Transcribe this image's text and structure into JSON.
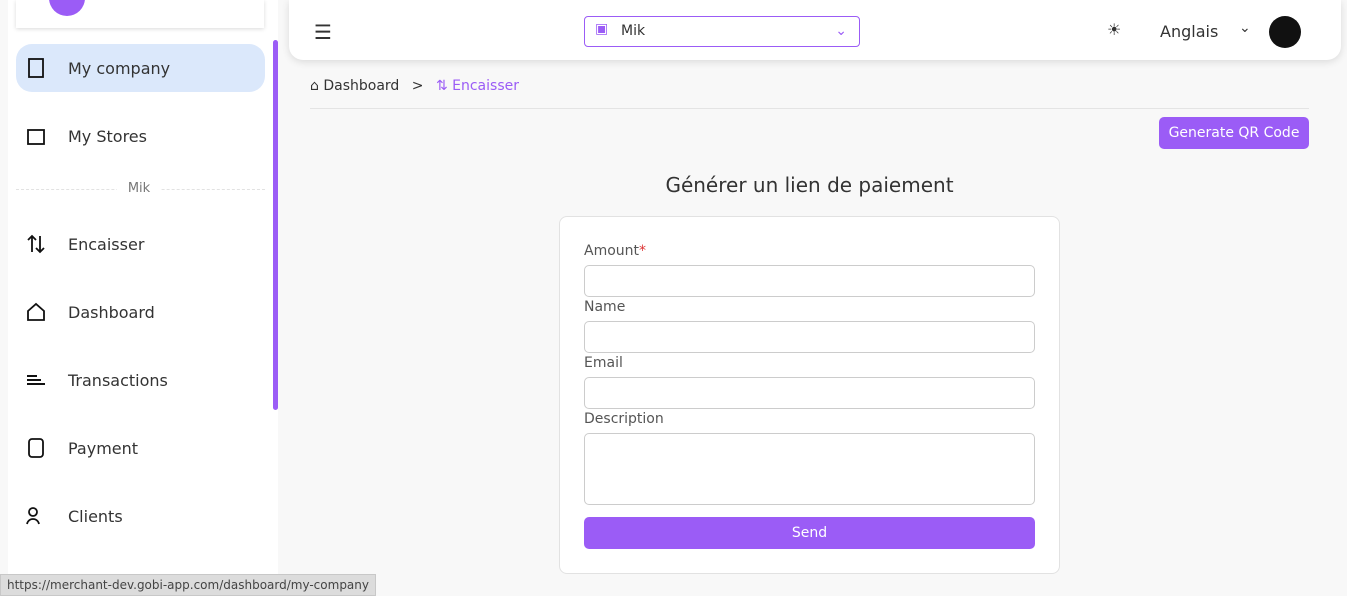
{
  "sidebar": {
    "sep": "Mik",
    "items": [
      {
        "label": "My company",
        "icon": "building-icon"
      },
      {
        "label": "My Stores",
        "icon": "store-icon"
      },
      {
        "label": "Encaisser",
        "icon": "swap-icon"
      },
      {
        "label": "Dashboard",
        "icon": "home-icon"
      },
      {
        "label": "Transactions",
        "icon": "list-icon"
      },
      {
        "label": "Payment",
        "icon": "wallet-icon"
      },
      {
        "label": "Clients",
        "icon": "users-icon"
      }
    ]
  },
  "topbar": {
    "store": "Mik",
    "lang": "Anglais"
  },
  "crumb": {
    "home": "Dashboard",
    "sep": ">",
    "current": "Encaisser"
  },
  "qr": "Generate QR Code",
  "title": "Générer un lien de paiement",
  "form": {
    "amount": "Amount",
    "req": "*",
    "name": "Name",
    "email": "Email",
    "description": "Description",
    "send": "Send"
  },
  "status": "https://merchant-dev.gobi-app.com/dashboard/my-company",
  "colors": {
    "accent": "#9b5cf6",
    "active": "#dbe8fb"
  }
}
